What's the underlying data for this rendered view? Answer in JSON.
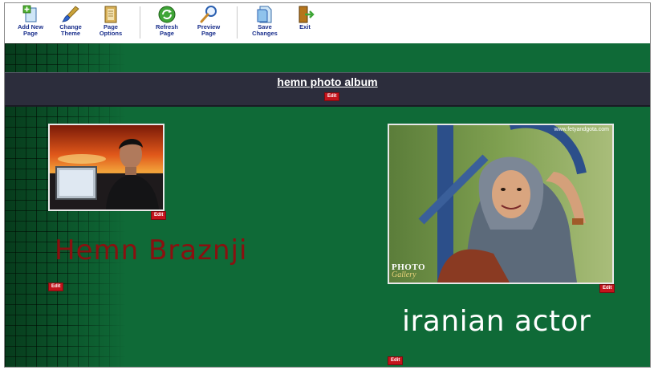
{
  "toolbar": {
    "buttons": [
      {
        "label": "Add New\nPage",
        "icon": "add-page-icon"
      },
      {
        "label": "Change\nTheme",
        "icon": "paint-brush-icon"
      },
      {
        "label": "Page\nOptions",
        "icon": "page-options-icon"
      },
      {
        "label": "Refresh\nPage",
        "icon": "refresh-icon"
      },
      {
        "label": "Preview\nPage",
        "icon": "magnifier-icon"
      },
      {
        "label": "Save\nChanges",
        "icon": "save-icon"
      },
      {
        "label": "Exit",
        "icon": "exit-door-icon"
      }
    ]
  },
  "page": {
    "album_title": "hemn photo album",
    "edit_label": "Edit",
    "name_text": "Hemn Braznji",
    "caption_text": "iranian actor",
    "photo2_watermark": "www.fetyandgota.com",
    "photo2_logo_line1": "PHOTO",
    "photo2_logo_line2": "Gallery"
  },
  "colors": {
    "page_background": "#0f6a37",
    "title_bar": "#2c2d3c",
    "name_text": "#8a1010",
    "edit_badge": "#c4141c",
    "toolbar_label": "#1a2f8c"
  }
}
